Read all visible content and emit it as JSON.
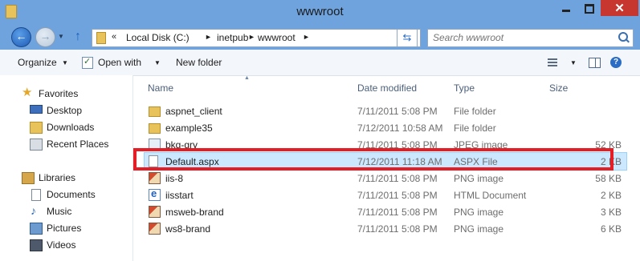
{
  "window": {
    "title": "wwwroot"
  },
  "nav": {
    "breadcrumb": [
      "Local Disk (C:)",
      "inetpub",
      "wwwroot"
    ],
    "breadcrumb_prefix": "«",
    "search_placeholder": "Search wwwroot"
  },
  "toolbar": {
    "organize": "Organize",
    "open_with": "Open with",
    "new_folder": "New folder"
  },
  "sidebar": {
    "favorites": {
      "label": "Favorites",
      "items": [
        "Desktop",
        "Downloads",
        "Recent Places"
      ]
    },
    "libraries": {
      "label": "Libraries",
      "items": [
        "Documents",
        "Music",
        "Pictures",
        "Videos"
      ]
    }
  },
  "columns": {
    "name": "Name",
    "date": "Date modified",
    "type": "Type",
    "size": "Size"
  },
  "files": [
    {
      "name": "aspnet_client",
      "date": "7/11/2011 5:08 PM",
      "type": "File folder",
      "size": "",
      "icon": "folder-icon"
    },
    {
      "name": "example35",
      "date": "7/12/2011 10:58 AM",
      "type": "File folder",
      "size": "",
      "icon": "folder-icon"
    },
    {
      "name": "bkg-gry",
      "date": "7/11/2011 5:08 PM",
      "type": "JPEG image",
      "size": "52 KB",
      "icon": "jpeg-icon"
    },
    {
      "name": "Default.aspx",
      "date": "7/12/2011 11:18 AM",
      "type": "ASPX File",
      "size": "2 KB",
      "icon": "aspx-file-icon",
      "selected": true
    },
    {
      "name": "iis-8",
      "date": "7/11/2011 5:08 PM",
      "type": "PNG image",
      "size": "58 KB",
      "icon": "png-icon"
    },
    {
      "name": "iisstart",
      "date": "7/11/2011 5:08 PM",
      "type": "HTML Document",
      "size": "2 KB",
      "icon": "html-icon"
    },
    {
      "name": "msweb-brand",
      "date": "7/11/2011 5:08 PM",
      "type": "PNG image",
      "size": "3 KB",
      "icon": "png-icon"
    },
    {
      "name": "ws8-brand",
      "date": "7/11/2011 5:08 PM",
      "type": "PNG image",
      "size": "6 KB",
      "icon": "png-icon"
    }
  ],
  "colors": {
    "titlebar": "#6fa3de",
    "selection": "#cce8ff",
    "highlight": "#e41e26",
    "close": "#c7372f"
  }
}
